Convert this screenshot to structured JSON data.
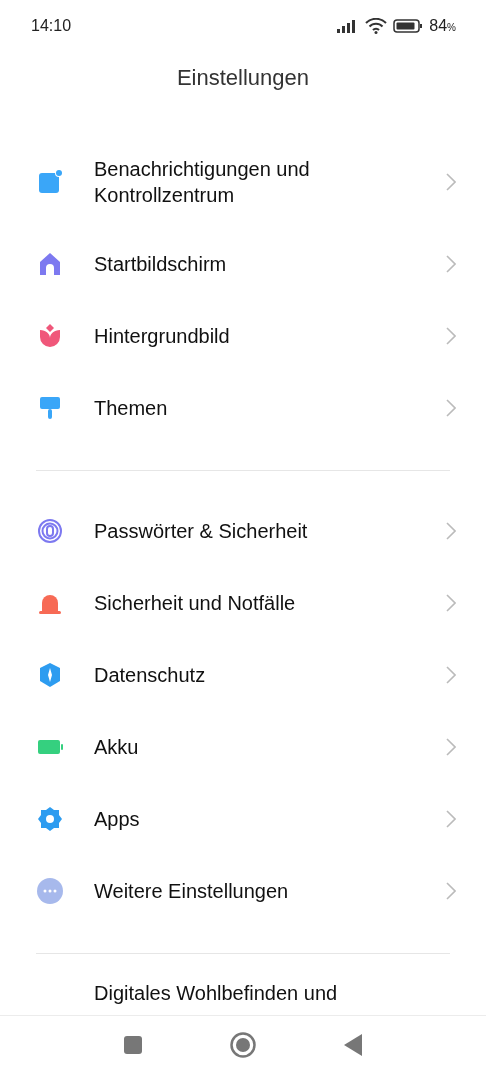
{
  "status_bar": {
    "time": "14:10",
    "battery": "84",
    "battery_unit": "%"
  },
  "title": "Einstellungen",
  "sections": [
    {
      "items": [
        {
          "label": "Benachrichtigungen und Kontrollzentrum"
        },
        {
          "label": "Startbildschirm"
        },
        {
          "label": "Hintergrundbild"
        },
        {
          "label": "Themen"
        }
      ]
    },
    {
      "items": [
        {
          "label": "Passwörter & Sicherheit"
        },
        {
          "label": "Sicherheit und Notfälle"
        },
        {
          "label": "Datenschutz"
        },
        {
          "label": "Akku"
        },
        {
          "label": "Apps"
        },
        {
          "label": "Weitere Einstellungen"
        }
      ]
    },
    {
      "items": [
        {
          "label": "Digitales Wohlbefinden und"
        }
      ]
    }
  ]
}
